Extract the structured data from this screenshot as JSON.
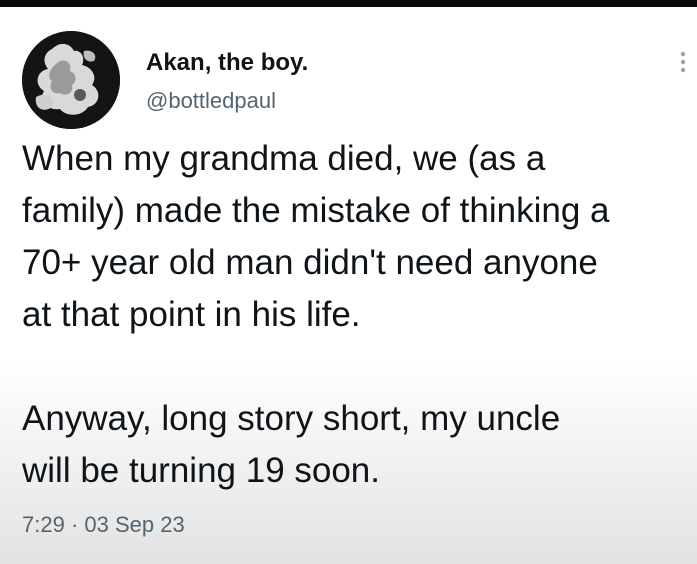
{
  "author": {
    "display_name": "Akan, the boy.",
    "handle": "@bottledpaul"
  },
  "tweet": {
    "lines": [
      "When my grandma died, we (as a",
      "family) made the mistake of thinking a",
      "70+ year old man didn't need anyone",
      "at that point in his life.",
      "",
      "Anyway, long story short, my uncle",
      "will be turning 19 soon."
    ]
  },
  "meta": {
    "time": "7:29",
    "separator": "·",
    "date": "03 Sep 23"
  },
  "icons": {
    "avatar": "profile-avatar",
    "more": "more-options-icon"
  },
  "colors": {
    "text": "#0f1419",
    "secondary": "#536471"
  }
}
